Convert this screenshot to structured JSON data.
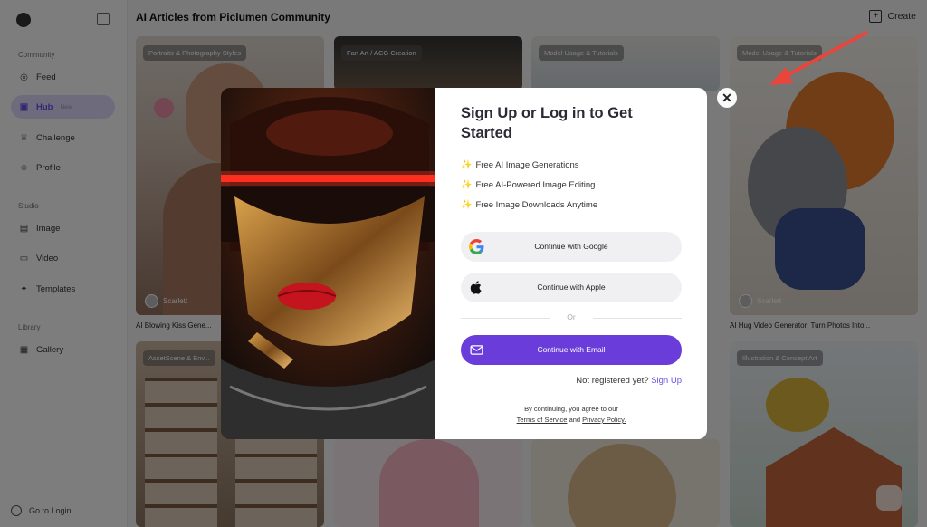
{
  "sidebar": {
    "sections": [
      {
        "label": "Community"
      },
      {
        "label": "Studio"
      },
      {
        "label": "Library"
      }
    ],
    "items": [
      {
        "label": "Feed",
        "icon": "compass-icon"
      },
      {
        "label": "Hub",
        "icon": "hub-icon",
        "badge": "New"
      },
      {
        "label": "Challenge",
        "icon": "trophy-icon"
      },
      {
        "label": "Profile",
        "icon": "profile-icon"
      },
      {
        "label": "Image",
        "icon": "image-icon"
      },
      {
        "label": "Video",
        "icon": "video-icon"
      },
      {
        "label": "Templates",
        "icon": "templates-icon"
      },
      {
        "label": "Gallery",
        "icon": "gallery-icon"
      }
    ],
    "go_to_login": "Go to Login"
  },
  "header": {
    "title": "AI Articles from Piclumen Community",
    "create_label": "Create"
  },
  "cards": [
    {
      "tag": "Portraits & Photography Styles",
      "author": "Scarlett",
      "caption": "AI Blowing Kiss Gene..."
    },
    {
      "tag": "Fan Art / ACG Creation",
      "author": "",
      "caption": ""
    },
    {
      "tag": "Model Usage & Tutorials",
      "author": "",
      "caption": ""
    },
    {
      "tag": "Model Usage & Tutorials",
      "author": "Scarlett",
      "caption": "AI Hug Video Generator: Turn Photos Into..."
    },
    {
      "tag": "AssetScene & Env...",
      "author": "",
      "caption": ""
    },
    {
      "tag": "",
      "author": "",
      "caption": ""
    },
    {
      "tag": "",
      "author": "",
      "caption": ""
    },
    {
      "tag": "Illustration & Concept Art",
      "author": "",
      "caption": ""
    }
  ],
  "modal": {
    "title": "Sign Up or Log in to Get Started",
    "features": [
      "Free AI Image Generations",
      "Free AI-Powered Image Editing",
      "Free Image Downloads Anytime"
    ],
    "google_label": "Continue with Google",
    "apple_label": "Continue with Apple",
    "or_label": "Or",
    "email_label": "Continue with Email",
    "not_registered": "Not registered yet?",
    "sign_up": "Sign Up",
    "legal_line1": "By continuing, you agree to our",
    "terms": "Terms of Service",
    "and": "and",
    "privacy": "Privacy Policy."
  },
  "colors": {
    "accent": "#6a3ddb",
    "link": "#6a4de0",
    "arrow": "#e8463c"
  }
}
